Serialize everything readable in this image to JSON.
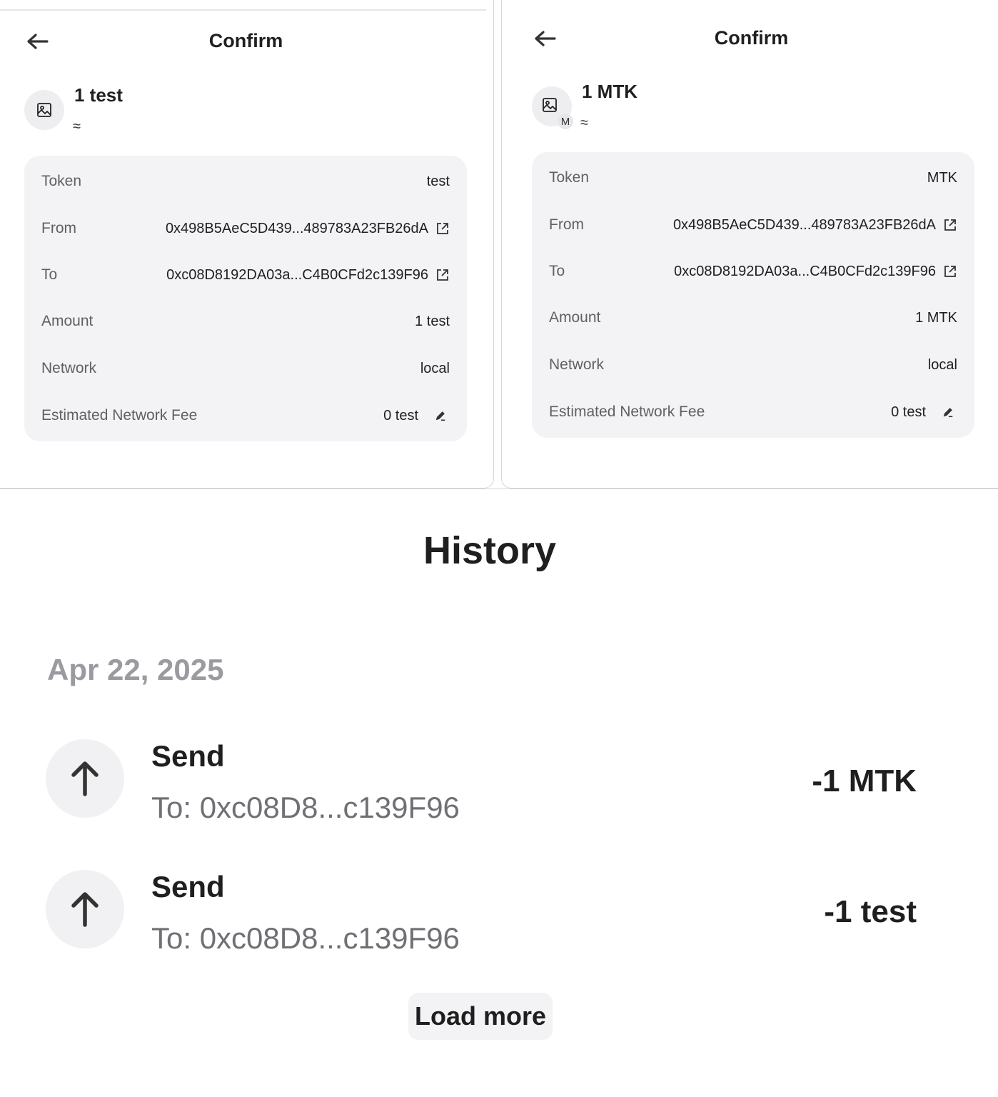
{
  "confirm_left": {
    "title": "Confirm",
    "amount_header": "1 test",
    "approx": "≈",
    "rows": [
      {
        "label": "Token",
        "value": "test"
      },
      {
        "label": "From",
        "value": "0x498B5AeC5D439...489783A23FB26dA"
      },
      {
        "label": "To",
        "value": "0xc08D8192DA03a...C4B0CFd2c139F96"
      },
      {
        "label": "Amount",
        "value": "1 test"
      },
      {
        "label": "Network",
        "value": "local"
      },
      {
        "label": "Estimated Network Fee",
        "value": "0 test"
      }
    ]
  },
  "confirm_right": {
    "title": "Confirm",
    "amount_header": "1 MTK",
    "approx": "≈",
    "badge": "M",
    "rows": [
      {
        "label": "Token",
        "value": "MTK"
      },
      {
        "label": "From",
        "value": "0x498B5AeC5D439...489783A23FB26dA"
      },
      {
        "label": "To",
        "value": "0xc08D8192DA03a...C4B0CFd2c139F96"
      },
      {
        "label": "Amount",
        "value": "1 MTK"
      },
      {
        "label": "Network",
        "value": "local"
      },
      {
        "label": "Estimated Network Fee",
        "value": "0 test"
      }
    ]
  },
  "history": {
    "title": "History",
    "date": "Apr 22, 2025",
    "transactions": [
      {
        "kind": "Send",
        "to": "To: 0xc08D8...c139F96",
        "amount": "-1 MTK"
      },
      {
        "kind": "Send",
        "to": "To: 0xc08D8...c139F96",
        "amount": "-1 test"
      }
    ],
    "load_more": "Load more"
  },
  "icons": {
    "back": "arrow-left-icon",
    "token": "image-placeholder-icon",
    "external": "external-link-icon",
    "edit": "pencil-icon",
    "send": "arrow-up-icon"
  }
}
